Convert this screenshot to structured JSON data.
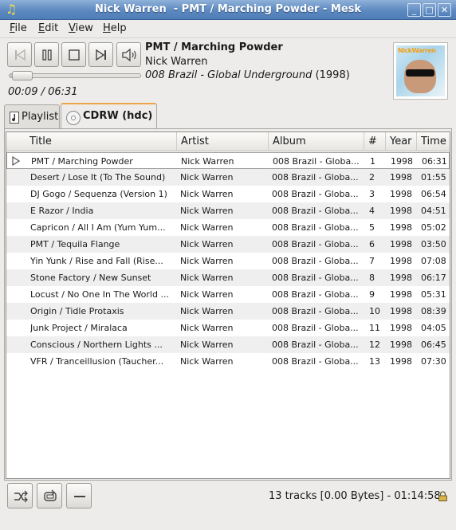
{
  "window": {
    "title": "Nick Warren  - PMT / Marching Powder - Mesk"
  },
  "menu": [
    {
      "label": "File",
      "mnemonic": "F",
      "rest": "ile"
    },
    {
      "label": "Edit",
      "mnemonic": "E",
      "rest": "dit"
    },
    {
      "label": "View",
      "mnemonic": "V",
      "rest": "iew"
    },
    {
      "label": "Help",
      "mnemonic": "H",
      "rest": "elp"
    }
  ],
  "now_playing": {
    "title": "PMT / Marching Powder",
    "artist": "Nick Warren",
    "album": "008 Brazil - Global Underground",
    "year": "(1998)",
    "time": "00:09 / 06:31",
    "progress_fraction": 0.023
  },
  "cover": {
    "brand": "NickWarren"
  },
  "tabs": [
    {
      "label": "Playlist",
      "icon": "music-note-icon"
    },
    {
      "label": "CDRW (hdc)",
      "icon": "cd-disc-icon",
      "active": true
    }
  ],
  "columns": [
    "Title",
    "Artist",
    "Album",
    "#",
    "Year",
    "Time"
  ],
  "tracks": [
    {
      "title": "PMT / Marching Powder",
      "artist": "Nick Warren",
      "album": "008 Brazil - Globa...",
      "num": "1",
      "year": "1998",
      "time": "06:31",
      "playing": true
    },
    {
      "title": "Desert / Lose It (To The Sound)",
      "artist": "Nick Warren",
      "album": "008 Brazil - Globa...",
      "num": "2",
      "year": "1998",
      "time": "01:55"
    },
    {
      "title": "DJ Gogo / Sequenza (Version 1)",
      "artist": "Nick Warren",
      "album": "008 Brazil - Globa...",
      "num": "3",
      "year": "1998",
      "time": "06:54"
    },
    {
      "title": "E Razor / India",
      "artist": "Nick Warren",
      "album": "008 Brazil - Globa...",
      "num": "4",
      "year": "1998",
      "time": "04:51"
    },
    {
      "title": "Capricon / All I Am (Yum Yum...",
      "artist": "Nick Warren",
      "album": "008 Brazil - Globa...",
      "num": "5",
      "year": "1998",
      "time": "05:02"
    },
    {
      "title": "PMT / Tequila Flange",
      "artist": "Nick Warren",
      "album": "008 Brazil - Globa...",
      "num": "6",
      "year": "1998",
      "time": "03:50"
    },
    {
      "title": "Yin Yunk / Rise and Fall (Rise...",
      "artist": "Nick Warren",
      "album": "008 Brazil - Globa...",
      "num": "7",
      "year": "1998",
      "time": "07:08"
    },
    {
      "title": "Stone Factory / New Sunset",
      "artist": "Nick Warren",
      "album": "008 Brazil - Globa...",
      "num": "8",
      "year": "1998",
      "time": "06:17"
    },
    {
      "title": "Locust / No One In The World ...",
      "artist": "Nick Warren",
      "album": "008 Brazil - Globa...",
      "num": "9",
      "year": "1998",
      "time": "05:31"
    },
    {
      "title": "Origin / Tidle Protaxis",
      "artist": "Nick Warren",
      "album": "008 Brazil - Globa...",
      "num": "10",
      "year": "1998",
      "time": "08:39"
    },
    {
      "title": "Junk Project / Miralaca",
      "artist": "Nick Warren",
      "album": "008 Brazil - Globa...",
      "num": "11",
      "year": "1998",
      "time": "04:05"
    },
    {
      "title": "Conscious / Northern Lights ...",
      "artist": "Nick Warren",
      "album": "008 Brazil - Globa...",
      "num": "12",
      "year": "1998",
      "time": "06:45"
    },
    {
      "title": "VFR / Tranceillusion (Taucher...",
      "artist": "Nick Warren",
      "album": "008 Brazil - Globa...",
      "num": "13",
      "year": "1998",
      "time": "07:30"
    }
  ],
  "status": {
    "text": "13 tracks [0.00 Bytes] - 01:14:58"
  },
  "colors": {
    "titlebar": "#5c89c0",
    "tab_accent": "#f0a44a",
    "row_alt": "#efefef"
  }
}
